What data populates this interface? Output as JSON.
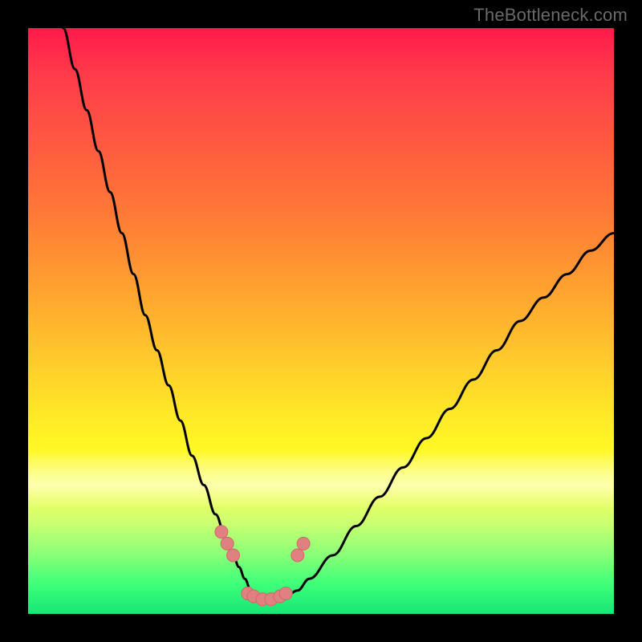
{
  "watermark": "TheBottleneck.com",
  "colors": {
    "frame": "#000000",
    "gradient_top": "#ff1a4a",
    "gradient_bottom": "#14e676",
    "curve_stroke": "#000000",
    "marker_fill": "#e08080",
    "marker_stroke": "#d06868"
  },
  "chart_data": {
    "type": "line",
    "title": "",
    "xlabel": "",
    "ylabel": "",
    "xlim": [
      0,
      100
    ],
    "ylim": [
      0,
      100
    ],
    "x": [
      6,
      8,
      10,
      12,
      14,
      16,
      18,
      20,
      22,
      24,
      26,
      28,
      30,
      32,
      34,
      35,
      36,
      37,
      38,
      39,
      40,
      42,
      44,
      46,
      48,
      52,
      56,
      60,
      64,
      68,
      72,
      76,
      80,
      84,
      88,
      92,
      96,
      100
    ],
    "values": [
      100,
      93,
      86,
      79,
      72,
      65,
      58,
      51,
      45,
      39,
      33,
      27,
      22,
      17,
      12,
      10,
      8,
      6,
      4,
      3,
      2,
      2,
      3,
      4,
      6,
      10,
      15,
      20,
      25,
      30,
      35,
      40,
      45,
      50,
      54,
      58,
      62,
      65
    ],
    "markers": [
      {
        "x": 33,
        "y": 14
      },
      {
        "x": 34,
        "y": 12
      },
      {
        "x": 35,
        "y": 10
      },
      {
        "x": 37.5,
        "y": 3.5
      },
      {
        "x": 38.5,
        "y": 3
      },
      {
        "x": 40,
        "y": 2.5
      },
      {
        "x": 41.5,
        "y": 2.5
      },
      {
        "x": 43,
        "y": 3
      },
      {
        "x": 44,
        "y": 3.5
      },
      {
        "x": 46,
        "y": 10
      },
      {
        "x": 47,
        "y": 12
      }
    ],
    "grid": false,
    "legend": false
  }
}
